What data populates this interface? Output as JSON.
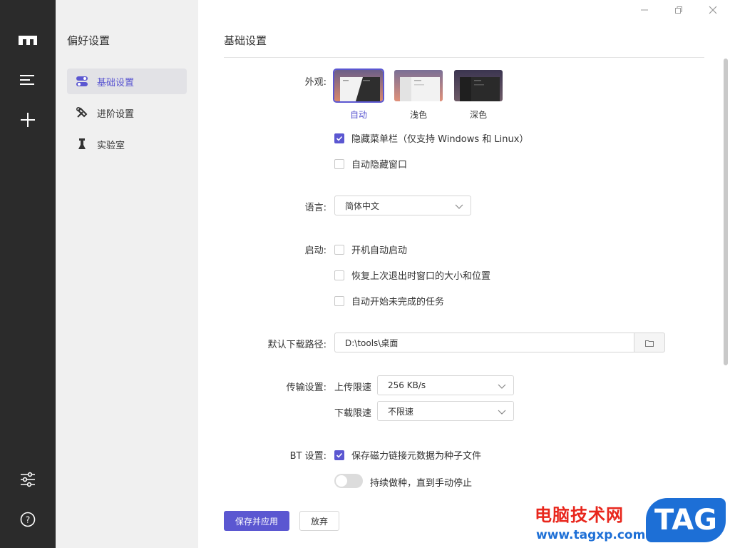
{
  "sidebar_nav": {
    "title": "偏好设置",
    "items": [
      {
        "label": "基础设置",
        "icon": "toggle-icon",
        "active": true
      },
      {
        "label": "进阶设置",
        "icon": "wrench-icon",
        "active": false
      },
      {
        "label": "实验室",
        "icon": "flask-icon",
        "active": false
      }
    ]
  },
  "rail": {
    "icons": [
      "app-logo-icon",
      "menu-icon",
      "plus-icon",
      "sliders-icon",
      "help-icon"
    ]
  },
  "content": {
    "title": "基础设置",
    "appearance": {
      "label": "外观:",
      "themes": [
        {
          "label": "自动",
          "selected": true
        },
        {
          "label": "浅色",
          "selected": false
        },
        {
          "label": "深色",
          "selected": false
        }
      ],
      "hide_menubar": {
        "label": "隐藏菜单栏（仅支持 Windows 和 Linux）",
        "checked": true
      },
      "auto_hide_window": {
        "label": "自动隐藏窗口",
        "checked": false
      }
    },
    "language": {
      "label": "语言:",
      "value": "简体中文"
    },
    "startup": {
      "label": "启动:",
      "options": [
        {
          "label": "开机自动启动",
          "checked": false
        },
        {
          "label": "恢复上次退出时窗口的大小和位置",
          "checked": false
        },
        {
          "label": "自动开始未完成的任务",
          "checked": false
        }
      ]
    },
    "download_path": {
      "label": "默认下载路径:",
      "value": "D:\\tools\\桌面"
    },
    "transfer": {
      "label": "传输设置:",
      "upload_label": "上传限速",
      "upload_value": "256 KB/s",
      "download_label": "下载限速",
      "download_value": "不限速"
    },
    "bt": {
      "label": "BT 设置:",
      "save_magnet": {
        "label": "保存磁力链接元数据为种子文件",
        "checked": true
      },
      "keep_seeding": {
        "label": "持续做种，直到手动停止",
        "on": false
      }
    },
    "buttons": {
      "save": "保存并应用",
      "discard": "放弃"
    }
  },
  "watermark": {
    "cn": "电脑技术网",
    "url": "www.tagxp.com",
    "logo": "TAG"
  },
  "colors": {
    "accent": "#5b57d1",
    "rail": "#2b2b2b",
    "nav_bg": "#f0f0f0"
  }
}
